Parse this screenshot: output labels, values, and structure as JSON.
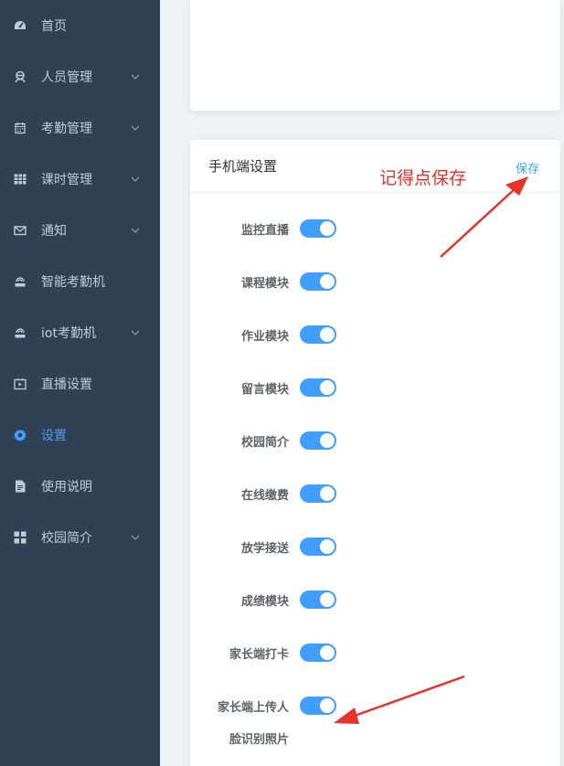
{
  "sidebar": {
    "items": [
      {
        "label": "首页",
        "icon": "dashboard-icon",
        "chevron": false,
        "active": false
      },
      {
        "label": "人员管理",
        "icon": "user-icon",
        "chevron": true,
        "active": false
      },
      {
        "label": "考勤管理",
        "icon": "calendar-icon",
        "chevron": true,
        "active": false
      },
      {
        "label": "课时管理",
        "icon": "table-icon",
        "chevron": true,
        "active": false
      },
      {
        "label": "通知",
        "icon": "mail-icon",
        "chevron": true,
        "active": false
      },
      {
        "label": "智能考勤机",
        "icon": "device-icon",
        "chevron": false,
        "active": false
      },
      {
        "label": "iot考勤机",
        "icon": "device-icon",
        "chevron": true,
        "active": false
      },
      {
        "label": "直播设置",
        "icon": "video-icon",
        "chevron": false,
        "active": false
      },
      {
        "label": "设置",
        "icon": "gear-icon",
        "chevron": false,
        "active": true
      },
      {
        "label": "使用说明",
        "icon": "document-icon",
        "chevron": false,
        "active": false
      },
      {
        "label": "校园简介",
        "icon": "grid-icon",
        "chevron": true,
        "active": false
      }
    ]
  },
  "settings_card": {
    "title": "手机端设置",
    "save_label": "保存",
    "toggles": [
      {
        "label": "监控直播",
        "on": true
      },
      {
        "label": "课程模块",
        "on": true
      },
      {
        "label": "作业模块",
        "on": true
      },
      {
        "label": "留言模块",
        "on": true
      },
      {
        "label": "校园简介",
        "on": true
      },
      {
        "label": "在线缴费",
        "on": true
      },
      {
        "label": "放学接送",
        "on": true
      },
      {
        "label": "成绩模块",
        "on": true
      },
      {
        "label": "家长端打卡",
        "on": true
      },
      {
        "label": "家长端上传人",
        "on": true
      }
    ],
    "last_toggle_continuation": "脸识别照片"
  },
  "annotation": {
    "text": "记得点保存",
    "color": "#e8322a"
  },
  "colors": {
    "sidebar_bg": "#304156",
    "sidebar_text": "#bfcbd9",
    "accent": "#409eff",
    "annotation_red": "#e8322a"
  }
}
